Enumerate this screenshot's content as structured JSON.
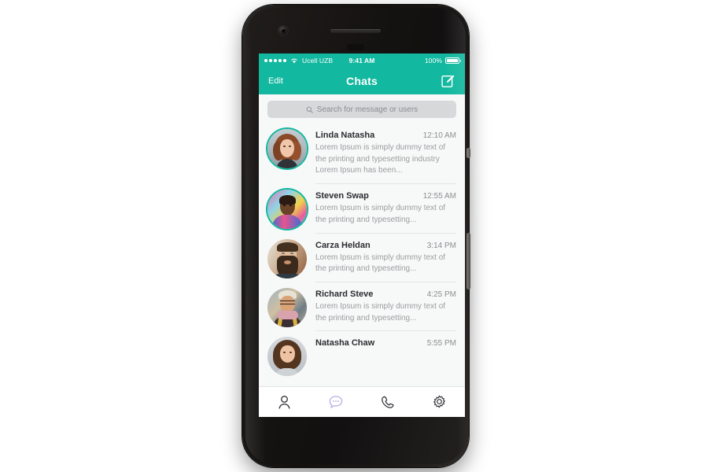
{
  "device": {
    "name": "smartphone-mockup",
    "camera_icon": "front-camera-icon",
    "speaker_icon": "earpiece-speaker-icon",
    "sensor_icon": "proximity-sensor-icon",
    "power_button": "power-button",
    "volume_button": "volume-button"
  },
  "status_bar": {
    "signal_icon": "signal-dots-icon",
    "wifi_icon": "wifi-icon",
    "carrier": "Ucell UZB",
    "time": "9:41 AM",
    "battery_percent": "100%",
    "battery_icon": "battery-full-icon"
  },
  "navbar": {
    "edit_label": "Edit",
    "title": "Chats",
    "compose_icon": "compose-pencil-icon",
    "background_color": "#12b89f",
    "text_color": "#ffffff"
  },
  "search": {
    "placeholder": "Search for message or users",
    "icon": "search-icon",
    "background_color": "#d6d8da"
  },
  "chats": [
    {
      "name": "Linda Natasha",
      "time": "12:10 AM",
      "preview": "Lorem Ipsum is simply dummy text of the printing and typesetting industry Lorem Ipsum has been...",
      "avatar": "avatar-linda-natasha",
      "online": true
    },
    {
      "name": "Steven Swap",
      "time": "12:55 AM",
      "preview": "Lorem Ipsum is simply dummy text of the printing and typesetting...",
      "avatar": "avatar-steven-swap",
      "online": true
    },
    {
      "name": "Carza Heldan",
      "time": "3:14 PM",
      "preview": "Lorem Ipsum is simply dummy text of the printing and typesetting...",
      "avatar": "avatar-carza-heldan",
      "online": false
    },
    {
      "name": "Richard Steve",
      "time": "4:25 PM",
      "preview": "Lorem Ipsum is simply dummy text of the printing and typesetting...",
      "avatar": "avatar-richard-steve",
      "online": false
    },
    {
      "name": "Natasha Chaw",
      "time": "5:55 PM",
      "preview": "",
      "avatar": "avatar-natasha-chaw",
      "online": false
    }
  ],
  "tabbar": {
    "items": [
      {
        "icon": "person-icon",
        "active": false
      },
      {
        "icon": "chat-bubble-icon",
        "active": true
      },
      {
        "icon": "phone-icon",
        "active": false
      },
      {
        "icon": "gear-icon",
        "active": false
      }
    ],
    "active_color": "#b4aee8",
    "inactive_color": "#2f3136"
  }
}
